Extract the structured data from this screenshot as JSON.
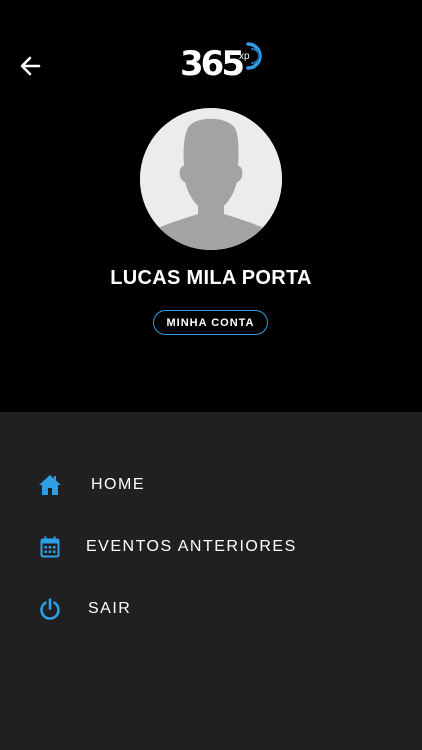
{
  "header": {
    "logo_text": "365",
    "logo_sub": "xp",
    "user_name": "LUCAS MILA PORTA",
    "account_button_label": "MINHA CONTA"
  },
  "menu": {
    "items": [
      {
        "label": "HOME",
        "icon": "home-icon"
      },
      {
        "label": "EVENTOS ANTERIORES",
        "icon": "calendar-icon"
      },
      {
        "label": "SAIR",
        "icon": "power-icon"
      }
    ]
  },
  "colors": {
    "header_bg": "#000000",
    "menu_bg": "#202020",
    "accent": "#2f9ee5",
    "text": "#ffffff"
  }
}
